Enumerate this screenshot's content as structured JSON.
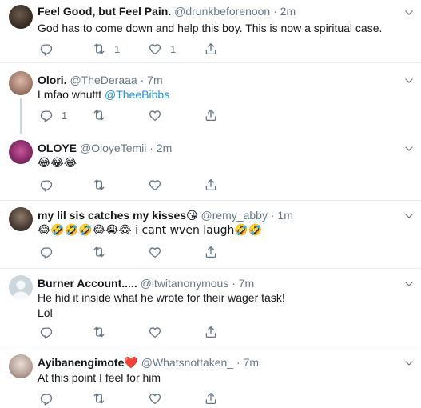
{
  "tweets": [
    {
      "name": "Feel Good, but Feel Pain.",
      "handle": "@drunkbeforenoon",
      "dot": "·",
      "time": "2m",
      "text": "God has to come down and help this boy. This is now a spiritual case.",
      "retweets": "1",
      "likes": "1"
    },
    {
      "name": "Olori.",
      "handle": "@TheDeraaa",
      "dot": "·",
      "time": "7m",
      "text_prefix": "Lmfao whuttt ",
      "mention": "@TheeBibbs",
      "replies": "1"
    },
    {
      "name": "OLOYE",
      "handle": "@OloyeTemii",
      "dot": "·",
      "time": "2m",
      "text": "😂😂😂"
    },
    {
      "name": "my lil sis catches my kisses😘",
      "handle": "@remy_abby",
      "dot": "·",
      "time": "1m",
      "text": "😂🤣🤣🤣😂😭😂 i cant wven laugh🤣🤣"
    },
    {
      "name": "Burner Account.....",
      "handle": "@itwitanonymous",
      "dot": "·",
      "time": "7m",
      "text_line1": "He hid it inside what he wrote for their wager task!",
      "text_line2": "Lol"
    },
    {
      "name": "Ayibanengimote❤️",
      "handle": "@Whatsnottaken_",
      "dot": "·",
      "time": "7m",
      "text": "At this point I feel for him"
    }
  ],
  "icons": {
    "reply": "reply-icon",
    "retweet": "retweet-icon",
    "like": "like-icon",
    "share": "share-icon",
    "caret": "chevron-down-icon"
  },
  "colors": {
    "secondary": "#657786",
    "link": "#1b95e0",
    "divider": "#e6ecf0"
  }
}
